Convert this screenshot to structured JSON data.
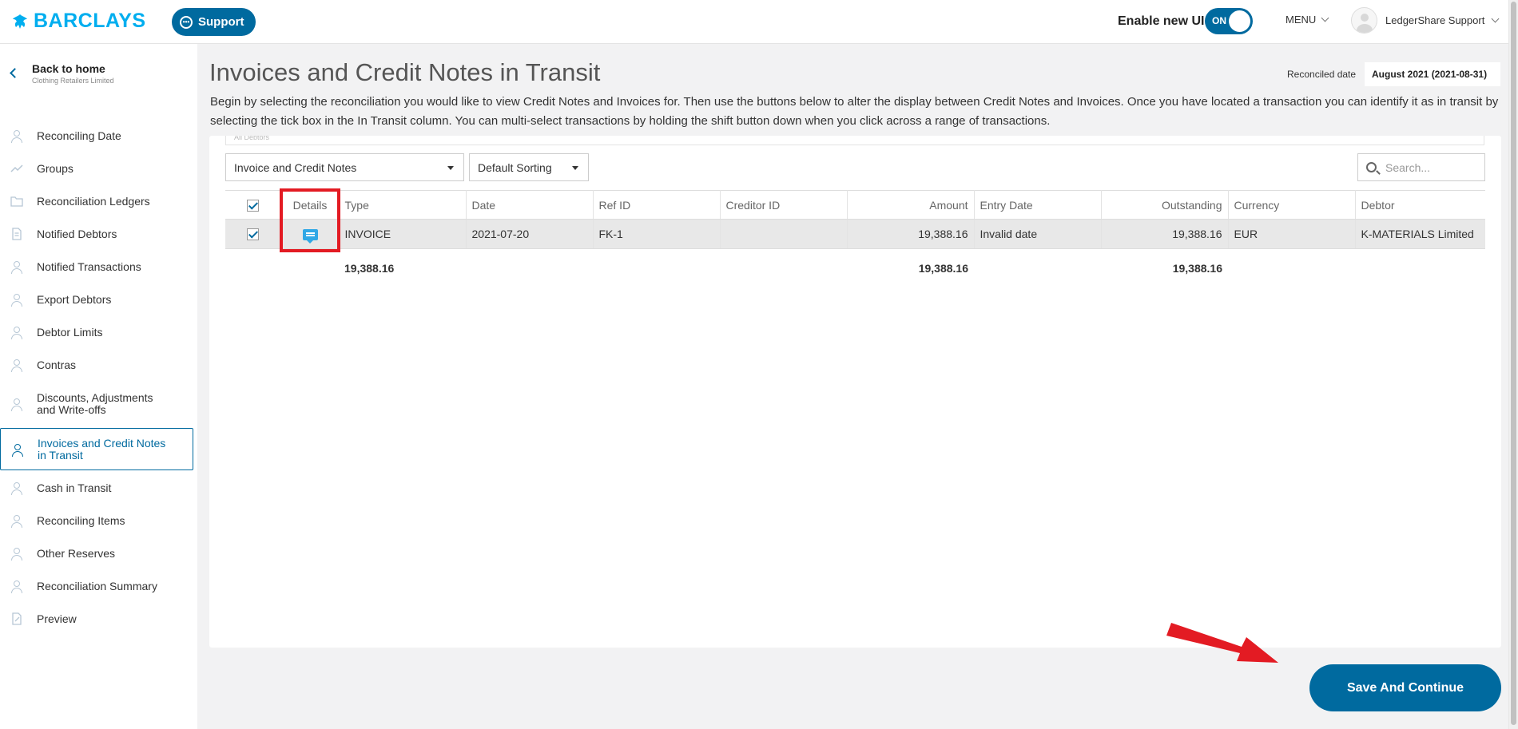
{
  "header": {
    "logo_text": "BARCLAYS",
    "support_label": "Support",
    "enable_ui_label": "Enable new UI",
    "toggle_label": "ON",
    "menu_label": "MENU",
    "user_name": "LedgerShare Support"
  },
  "sidebar": {
    "back_title": "Back to home",
    "back_sub": "Clothing Retailers Limited",
    "items": [
      {
        "label": "Reconciling Date"
      },
      {
        "label": "Groups"
      },
      {
        "label": "Reconciliation Ledgers"
      },
      {
        "label": "Notified Debtors"
      },
      {
        "label": "Notified Transactions"
      },
      {
        "label": "Export Debtors"
      },
      {
        "label": "Debtor Limits"
      },
      {
        "label": "Contras"
      },
      {
        "label": "Discounts, Adjustments and Write-offs"
      },
      {
        "label": "Invoices and Credit Notes in Transit"
      },
      {
        "label": "Cash in Transit"
      },
      {
        "label": "Reconciling Items"
      },
      {
        "label": "Other Reserves"
      },
      {
        "label": "Reconciliation Summary"
      },
      {
        "label": "Preview"
      }
    ]
  },
  "main": {
    "title": "Invoices and Credit Notes in Transit",
    "reconciled_label": "Reconciled date",
    "reconciled_value": "August 2021 (2021-08-31)",
    "intro": "Begin by selecting the reconciliation you would like to view Credit Notes and Invoices for. Then use the buttons below to alter the display between Credit Notes and Invoices. Once you have located a transaction you can identify it as in transit by selecting the tick box in the In Transit column. You can multi-select transactions by holding the shift button down when you click across a range of transactions.",
    "debtor_filter": "All Debtors",
    "type_filter": "Invoice and Credit Notes",
    "sort_filter": "Default Sorting",
    "search_placeholder": "Search...",
    "save_label": "Save And Continue"
  },
  "table": {
    "columns": [
      "Details",
      "Type",
      "Date",
      "Ref ID",
      "Creditor ID",
      "Amount",
      "Entry Date",
      "Outstanding",
      "Currency",
      "Debtor"
    ],
    "rows": [
      {
        "type": "INVOICE",
        "date": "2021-07-20",
        "ref_id": "FK-1",
        "creditor_id": "",
        "amount": "19,388.16",
        "entry_date": "Invalid date",
        "outstanding": "19,388.16",
        "currency": "EUR",
        "debtor": "K-MATERIALS Limited"
      }
    ],
    "totals": {
      "type": "19,388.16",
      "amount": "19,388.16",
      "outstanding": "19,388.16"
    }
  },
  "colors": {
    "brand": "#006a9f",
    "logo": "#00aeef",
    "highlight": "#e31b23"
  }
}
